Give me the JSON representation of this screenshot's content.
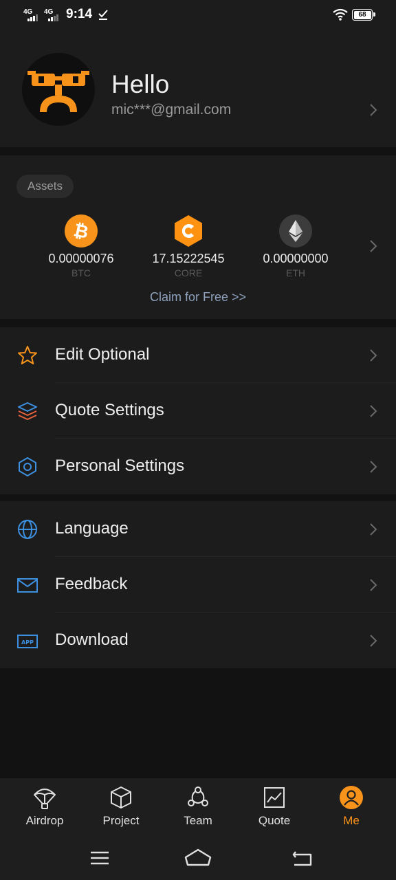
{
  "status_bar": {
    "signal1": "4G",
    "signal2": "4G",
    "time": "9:14",
    "battery": "68"
  },
  "profile": {
    "greeting": "Hello",
    "email": "mic***@gmail.com"
  },
  "assets": {
    "tag": "Assets",
    "coins": [
      {
        "amount": "0.00000076",
        "symbol": "BTC",
        "color": "#f7931a"
      },
      {
        "amount": "17.15222545",
        "symbol": "CORE",
        "color": "#ff9211"
      },
      {
        "amount": "0.00000000",
        "symbol": "ETH",
        "color": "#3c3c3d"
      }
    ],
    "claim": "Claim for Free >>"
  },
  "menu1": [
    {
      "label": "Edit Optional",
      "icon": "star-icon"
    },
    {
      "label": "Quote Settings",
      "icon": "layers-icon"
    },
    {
      "label": "Personal Settings",
      "icon": "hexagon-settings-icon"
    }
  ],
  "menu2": [
    {
      "label": "Language",
      "icon": "globe-icon"
    },
    {
      "label": "Feedback",
      "icon": "mail-icon"
    },
    {
      "label": "Download",
      "icon": "app-icon"
    }
  ],
  "tabs": [
    {
      "label": "Airdrop",
      "icon": "parachute-icon"
    },
    {
      "label": "Project",
      "icon": "cube-icon"
    },
    {
      "label": "Team",
      "icon": "team-icon"
    },
    {
      "label": "Quote",
      "icon": "chart-icon"
    },
    {
      "label": "Me",
      "icon": "user-icon",
      "active": true
    }
  ],
  "colors": {
    "accent": "#f7931a",
    "background": "#121212",
    "card": "#1c1c1c",
    "link": "#8ea2bd"
  }
}
